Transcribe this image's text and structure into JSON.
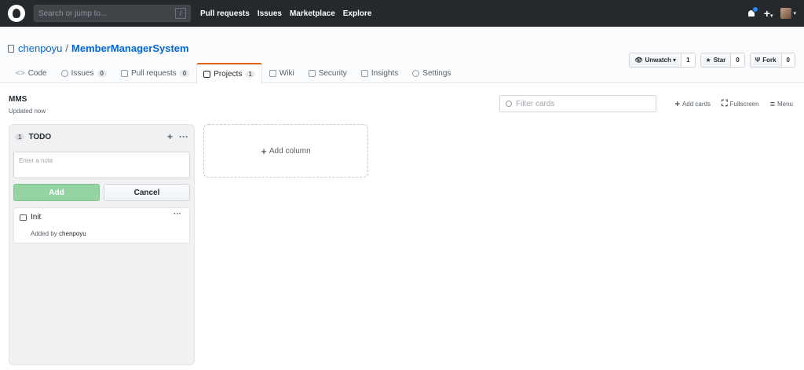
{
  "header": {
    "search_placeholder": "Search or jump to...",
    "slash_key": "/",
    "nav": [
      "Pull requests",
      "Issues",
      "Marketplace",
      "Explore"
    ],
    "plus": "+",
    "caret": "▾"
  },
  "repo": {
    "owner": "chenpoyu",
    "separator": "/",
    "name": "MemberManagerSystem",
    "watch": {
      "label": "Unwatch ▾",
      "count": "1"
    },
    "star": {
      "label": "Star",
      "count": "0"
    },
    "fork": {
      "label": "Fork",
      "count": "0"
    },
    "tabs": [
      {
        "label": "Code",
        "icon": "code-icon"
      },
      {
        "label": "Issues",
        "counter": "0",
        "icon": "issue-icon"
      },
      {
        "label": "Pull requests",
        "counter": "0",
        "icon": "pull-request-icon"
      },
      {
        "label": "Projects",
        "counter": "1",
        "icon": "project-icon",
        "selected": true
      },
      {
        "label": "Wiki",
        "icon": "wiki-icon"
      },
      {
        "label": "Security",
        "icon": "shield-icon"
      },
      {
        "label": "Insights",
        "icon": "graph-icon"
      },
      {
        "label": "Settings",
        "icon": "gear-icon"
      }
    ]
  },
  "project": {
    "name": "MMS",
    "updated": "Updated now",
    "filter_placeholder": "Filter cards",
    "add_cards": "Add cards",
    "fullscreen": "Fullscreen",
    "menu": "Menu",
    "columns": [
      {
        "count": "1",
        "title": "TODO",
        "note_placeholder": "Enter a note",
        "add_label": "Add",
        "cancel_label": "Cancel",
        "cards": [
          {
            "title": "Init",
            "added_by_prefix": "Added by",
            "added_by": "chenpoyu"
          }
        ]
      }
    ],
    "add_column": "Add column"
  },
  "colors": {
    "header_bg": "#24292e",
    "link": "#0366d6",
    "selected_tab_accent": "#e36209",
    "add_button_bg": "#94d3a2",
    "notification_dot": "#2188ff"
  }
}
